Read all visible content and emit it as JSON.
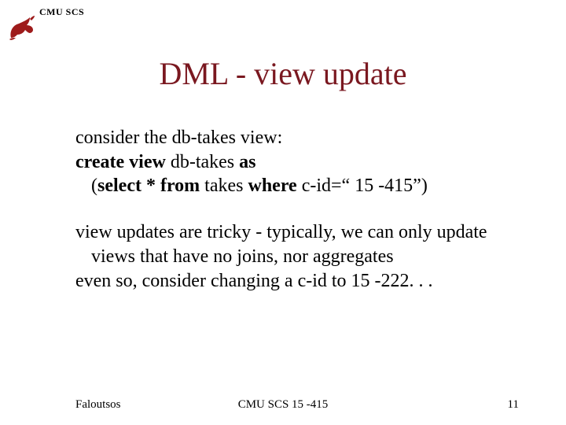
{
  "header": {
    "org": "CMU SCS"
  },
  "title": "DML - view update",
  "body": {
    "line1": "consider the db-takes view:",
    "line2_pre": "create view ",
    "line2_mid": "db-takes ",
    "line2_post": "as",
    "line3_a": "(",
    "line3_b": "select * from ",
    "line3_c": "takes ",
    "line3_d": "where ",
    "line3_e": "c-id=“ 15 -415”)",
    "para2_l1": "view updates are tricky - typically, we can only update views that have no joins, nor aggregates",
    "para2_l2": "even so, consider changing a c-id to 15 -222. . ."
  },
  "footer": {
    "left": "Faloutsos",
    "center": "CMU SCS 15 -415",
    "right": "11"
  }
}
